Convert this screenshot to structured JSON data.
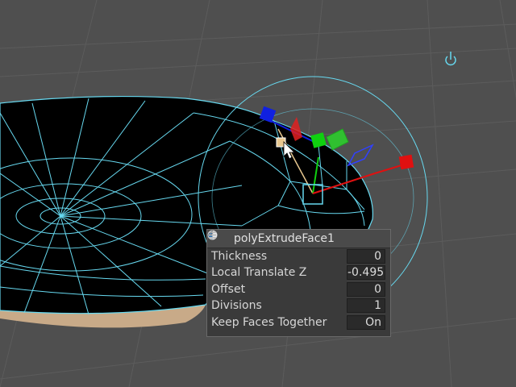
{
  "viewport": {
    "background": "#4f4f4f",
    "wire_color": "#67d9f0",
    "icons": {
      "pivot": "power-symbol-icon"
    }
  },
  "manipulator": {
    "x_axis_color": "#e01010",
    "y_axis_color": "#10d010",
    "z_axis_color": "#1020e0",
    "plane_xy_color": "#e02020",
    "plane_yz_color": "#3040ff",
    "plane_xz_color": "#30c030"
  },
  "panel": {
    "title": "polyExtrudeFace1",
    "attributes": [
      {
        "label": "Thickness",
        "value": "0"
      },
      {
        "label": "Local Translate Z",
        "value": "-0.495"
      },
      {
        "label": "Offset",
        "value": "0"
      },
      {
        "label": "Divisions",
        "value": "1"
      },
      {
        "label": "Keep Faces Together",
        "value": "On"
      }
    ]
  }
}
